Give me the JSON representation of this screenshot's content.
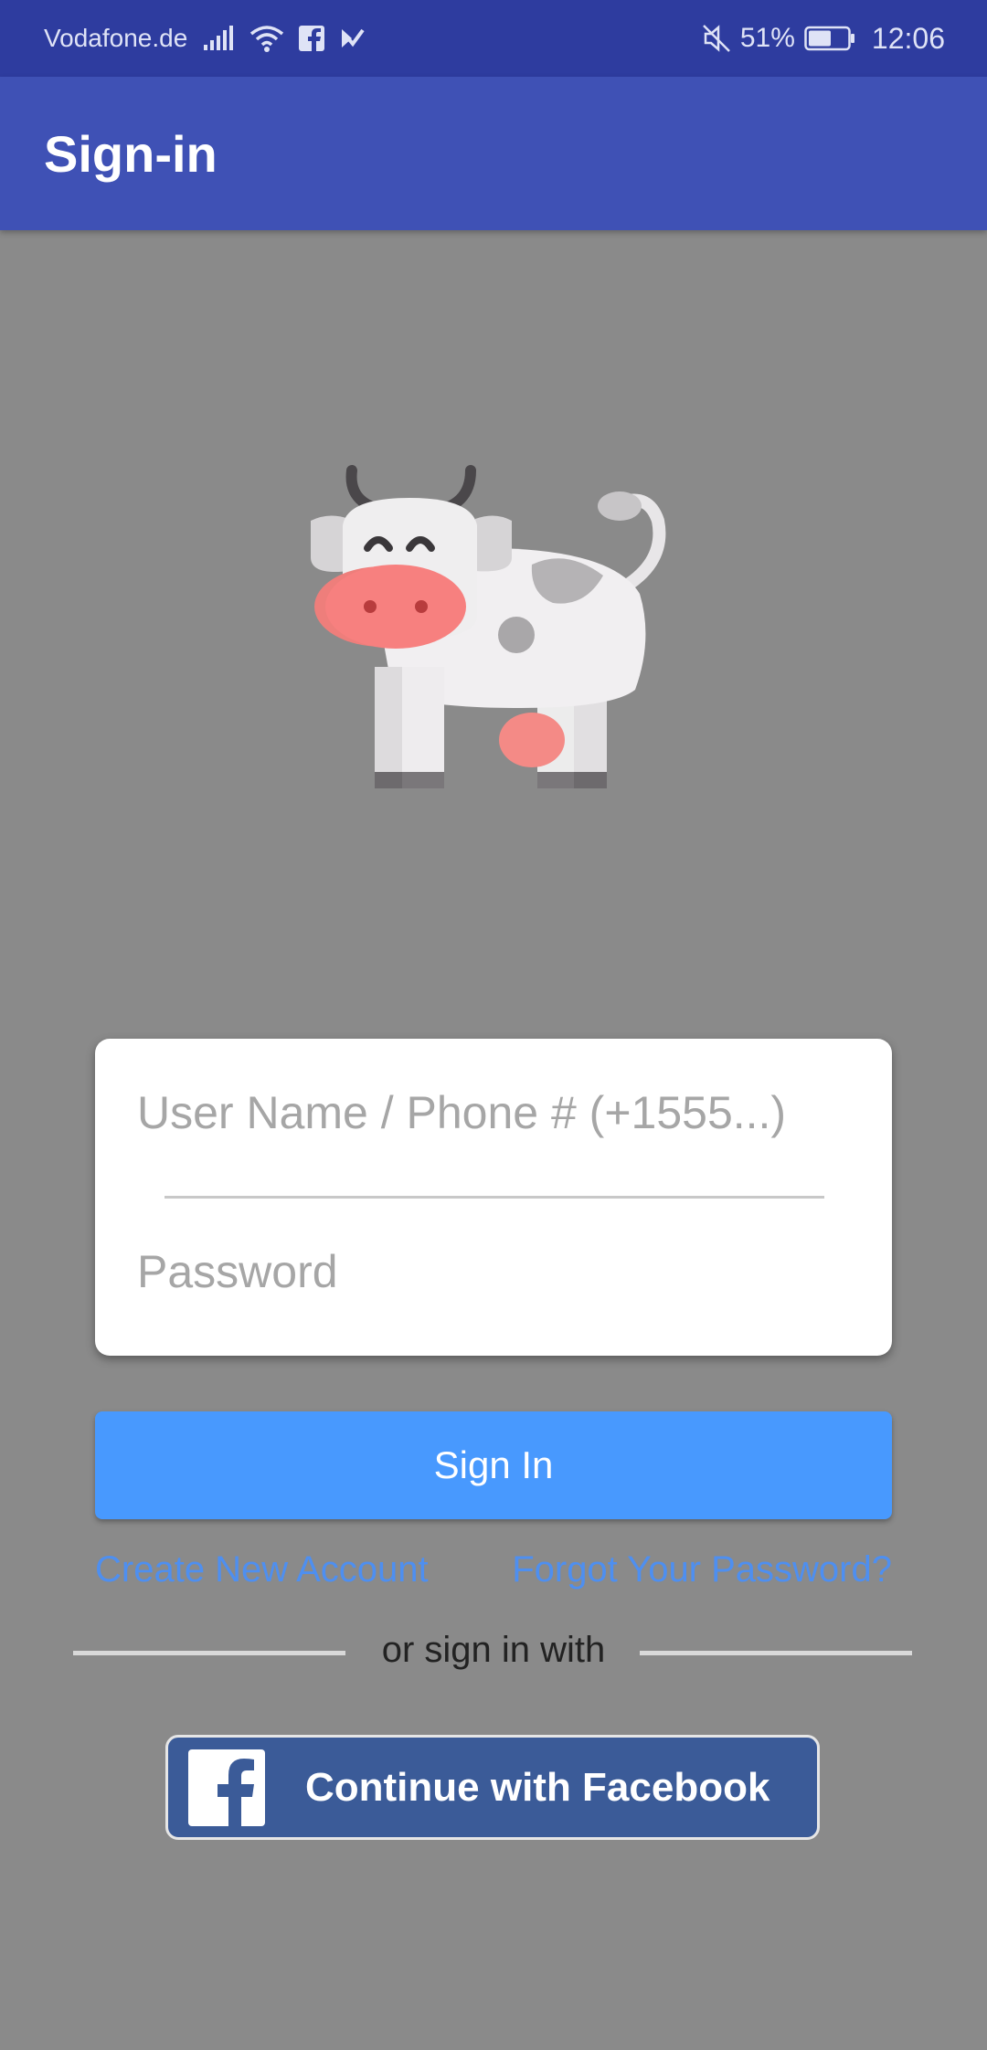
{
  "status_bar": {
    "carrier": "Vodafone.de",
    "battery_percent": "51%",
    "time": "12:06",
    "icons": [
      "signal-icon",
      "wifi-icon",
      "facebook-notification-icon",
      "check-notification-icon",
      "mute-icon",
      "battery-icon"
    ]
  },
  "app_bar": {
    "title": "Sign-in"
  },
  "logo": {
    "name": "cow-logo"
  },
  "login_form": {
    "username_placeholder": "User Name / Phone # (+1555...)",
    "password_placeholder": "Password"
  },
  "actions": {
    "sign_in_label": "Sign In",
    "create_account_label": "Create New Account",
    "forgot_password_label": "Forgot Your Password?"
  },
  "social": {
    "divider_text": "or sign in with",
    "facebook_label": "Continue with Facebook"
  },
  "colors": {
    "status_bar": "#2e3c9f",
    "app_bar": "#3f51b5",
    "background": "#8a8a8a",
    "sign_in_button": "#4899fe",
    "link": "#4e8ff0",
    "facebook": "#3b5b98"
  }
}
